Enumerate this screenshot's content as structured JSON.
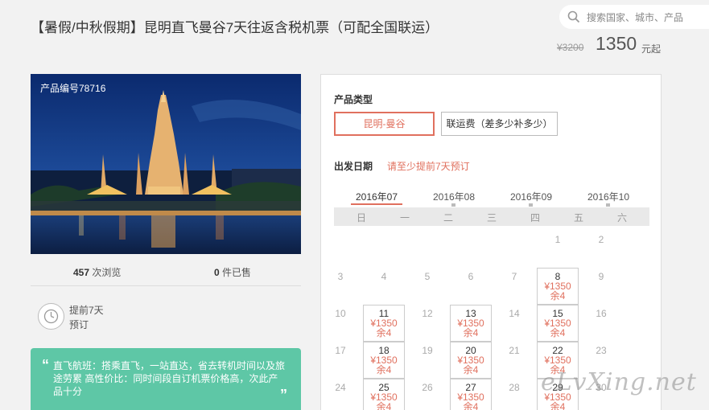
{
  "title": "【暑假/中秋假期】昆明直飞曼谷7天往返含税机票（可配全国联运）",
  "search": {
    "placeholder": "搜索国家、城市、产品",
    "icon": "search-icon"
  },
  "price": {
    "original": "¥3200",
    "current": "1350",
    "unit": "元起"
  },
  "product": {
    "code_label": "产品编号78716"
  },
  "stats": {
    "views_count": "457",
    "views_label": "次浏览",
    "sold_count": "0",
    "sold_label": "件已售"
  },
  "advance": {
    "line1": "提前7天",
    "line2": "预订",
    "icon": "clock-icon"
  },
  "highlights": {
    "open_quote": "“",
    "close_quote": "”",
    "text": "直飞航班：搭乘直飞，一站直达，省去转机时间以及旅途劳累 高性价比：同时间段自订机票价格高，次此产品十分"
  },
  "panel": {
    "type_label": "产品类型",
    "types": [
      "昆明-曼谷",
      "联运费（差多少补多少）"
    ],
    "date_label": "出发日期",
    "date_note": "请至少提前7天预订",
    "months": [
      "2016年07",
      "2016年08",
      "2016年09",
      "2016年10"
    ],
    "weekdays": [
      "日",
      "一",
      "二",
      "三",
      "四",
      "五",
      "六"
    ],
    "days": [
      {
        "d": "1"
      },
      {
        "d": "2"
      },
      {
        "d": "3"
      },
      {
        "d": "4"
      },
      {
        "d": "5"
      },
      {
        "d": "6"
      },
      {
        "d": "7"
      },
      {
        "d": "8",
        "price": "¥1350",
        "remain": "余4"
      },
      {
        "d": "9"
      },
      {
        "d": "10"
      },
      {
        "d": "11",
        "price": "¥1350",
        "remain": "余4"
      },
      {
        "d": "12"
      },
      {
        "d": "13",
        "price": "¥1350",
        "remain": "余4"
      },
      {
        "d": "14"
      },
      {
        "d": "15",
        "price": "¥1350",
        "remain": "余4"
      },
      {
        "d": "16"
      },
      {
        "d": "17"
      },
      {
        "d": "18",
        "price": "¥1350",
        "remain": "余4"
      },
      {
        "d": "19"
      },
      {
        "d": "20",
        "price": "¥1350",
        "remain": "余4"
      },
      {
        "d": "21"
      },
      {
        "d": "22",
        "price": "¥1350",
        "remain": "余4"
      },
      {
        "d": "23"
      },
      {
        "d": "24"
      },
      {
        "d": "25",
        "price": "¥1350",
        "remain": "余4"
      },
      {
        "d": "26"
      },
      {
        "d": "27",
        "price": "¥1350",
        "remain": "余4"
      },
      {
        "d": "28"
      },
      {
        "d": "29",
        "price": "¥1350",
        "remain": "余4"
      },
      {
        "d": "30"
      }
    ]
  },
  "watermark": "eLvXing.net",
  "colors": {
    "accent": "#e0705e",
    "green": "#5ec7a6"
  }
}
